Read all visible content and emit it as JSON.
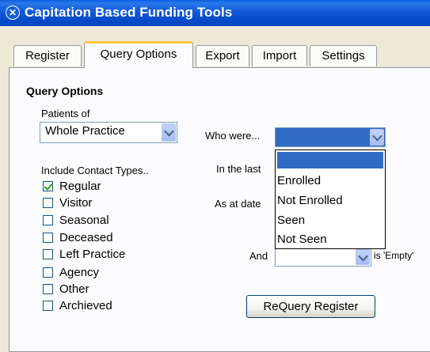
{
  "window": {
    "title": "Capitation Based Funding Tools",
    "icon": "app-logo-icon"
  },
  "tabs": [
    {
      "label": "Register",
      "active": false
    },
    {
      "label": "Query Options",
      "active": true
    },
    {
      "label": "Export",
      "active": false
    },
    {
      "label": "Import",
      "active": false
    },
    {
      "label": "Settings",
      "active": false
    }
  ],
  "query_options": {
    "section_title": "Query Options",
    "patients_of_label": "Patients of",
    "patients_of_value": "Whole Practice",
    "include_contact_types_label": "Include Contact Types..",
    "contact_types": [
      {
        "label": "Regular",
        "checked": true
      },
      {
        "label": "Visitor",
        "checked": false
      },
      {
        "label": "Seasonal",
        "checked": false
      },
      {
        "label": "Deceased",
        "checked": false
      },
      {
        "label": "Left Practice",
        "checked": false
      },
      {
        "label": "Agency",
        "checked": false
      },
      {
        "label": "Other",
        "checked": false
      },
      {
        "label": "Archieved",
        "checked": false
      }
    ],
    "who_were_label": "Who were...",
    "who_were_value": "",
    "who_were_options": [
      "",
      "Enrolled",
      "Not Enrolled",
      "Seen",
      "Not Seen"
    ],
    "in_the_last_label": "In the last",
    "as_at_date_label": "As at date",
    "and_label": "And",
    "is_empty_label": "is 'Empty'",
    "requery_button": "ReQuery Register"
  },
  "colors": {
    "titlebar": "#0a5fe0",
    "selection": "#316ac5",
    "active_tab_accent": "#ffc83c",
    "window_bg": "#ece9d8"
  }
}
